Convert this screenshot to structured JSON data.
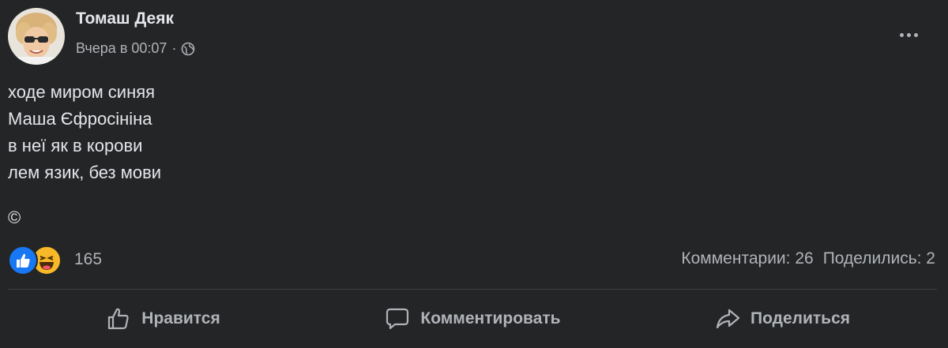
{
  "post": {
    "author": "Томаш Деяк",
    "timestamp": "Вчера в 00:07",
    "separator": "·",
    "privacy_icon": "globe-icon",
    "menu_icon": "more-options-icon",
    "text_lines": [
      "ходе миром синяя",
      "Маша Єфросініна",
      "в неї як в корови",
      "лем язик, без мови"
    ],
    "copyright": "©"
  },
  "reactions": {
    "icons": [
      "like-reaction-icon",
      "haha-reaction-icon"
    ],
    "count": "165"
  },
  "stats": {
    "comments": "Комментарии: 26",
    "shares": "Поделились: 2"
  },
  "actions": {
    "like": "Нравится",
    "comment": "Комментировать",
    "share": "Поделиться"
  },
  "colors": {
    "background": "#242526",
    "primary_text": "#e4e6eb",
    "secondary_text": "#b0b3b8",
    "like_blue": "#1877f2",
    "haha_yellow": "#f7b928",
    "divider": "#3e4042"
  }
}
